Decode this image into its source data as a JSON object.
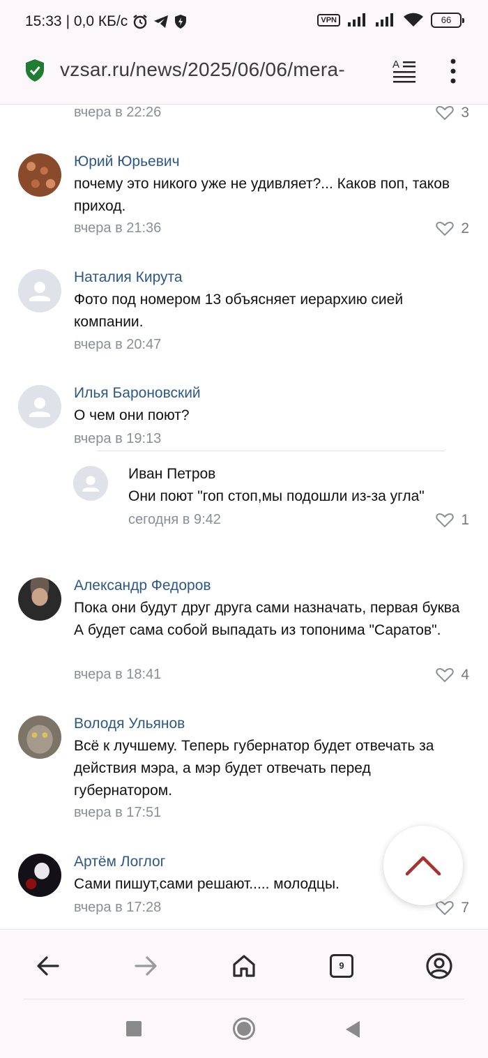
{
  "status_bar": {
    "time": "15:33",
    "net_speed": "| 0,0 КБ/с",
    "vpn": "VPN",
    "battery": "66"
  },
  "url_bar": {
    "url": "vzsar.ru/news/2025/06/06/mera-"
  },
  "comments": [
    {
      "author": "",
      "text": "",
      "date": "вчера в 22:26",
      "likes": "3"
    },
    {
      "author": "Юрий Юрьевич",
      "text": "почему это никого уже не удивляет?... Каков поп, таков приход.",
      "date": "вчера в 21:36",
      "likes": "2"
    },
    {
      "author": "Наталия Кирута",
      "text": "Фото под номером 13 объясняет иерархию сией компании.",
      "date": "вчера в 20:47",
      "likes": ""
    },
    {
      "author": "Илья Бароновский",
      "text": "О чем они поют?",
      "date": "вчера в 19:13",
      "likes": ""
    },
    {
      "author": "Иван Петров",
      "text": "Они поют \"гоп стоп,мы подошли из-за угла\"",
      "date": "сегодня в 9:42",
      "likes": "1"
    },
    {
      "author": "Александр Федоров",
      "text": "Пока они будут друг друга сами назначать, первая буква А будет сама собой выпадать из топонима \"Саратов\".",
      "date": "вчера в 18:41",
      "likes": "4"
    },
    {
      "author": "Володя Ульянов",
      "text": "Всё к лучшему. Теперь губернатор будет отвечать за действия мэра, а мэр будет отвечать перед губернатором.",
      "date": "вчера в 17:51",
      "likes": ""
    },
    {
      "author": "Артём Логлог",
      "text": "Сами пишут,сами решают..... молодцы.",
      "date": "вчера в 17:28",
      "likes": "7"
    }
  ],
  "toolbar": {
    "tab_count": "9"
  },
  "colors": {
    "author_link": "#2d5885",
    "date_gray": "#8a8f96",
    "fab_arrow": "#a83232",
    "chrome_bg": "#fbf7fb",
    "secure_green": "#1e7d32"
  },
  "icons": [
    "alarm-icon",
    "telegram-icon",
    "shield-icon",
    "signal-icon",
    "wifi-icon",
    "secure-shield-icon",
    "reader-mode-icon",
    "menu-icon",
    "heart-icon",
    "scroll-top-icon",
    "back-icon",
    "forward-icon",
    "home-icon",
    "tabs-icon",
    "account-icon",
    "recents-icon",
    "home-circle-icon",
    "system-back-icon"
  ]
}
